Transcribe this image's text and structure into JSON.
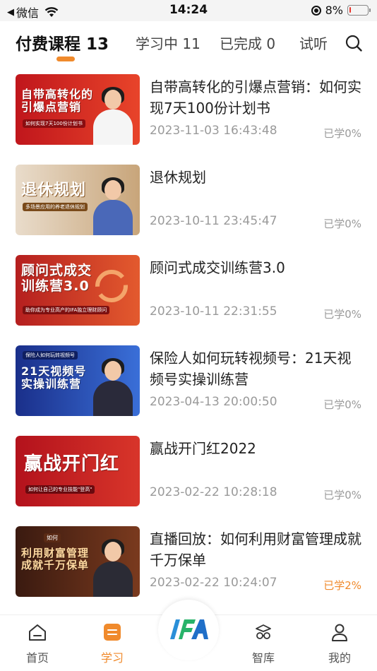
{
  "status_bar": {
    "back_glyph": "◀",
    "carrier": "微信",
    "time": "14:24",
    "battery_percent": "8%",
    "battery_level": 0.08
  },
  "tabs": [
    {
      "label": "付费课程 13",
      "active": true
    },
    {
      "label": "学习中 11",
      "active": false
    },
    {
      "label": "已完成 0",
      "active": false
    },
    {
      "label": "试听",
      "active": false
    }
  ],
  "courses": [
    {
      "title": "自带高转化的引爆点营销：如何实现7天100份计划书",
      "time": "2023-11-03 16:43:48",
      "progress": "已学0%",
      "thumb_title": "自带高转化的\n引爆点营销",
      "thumb_sub": "如何实现7天100份计划书",
      "bg_from": "#c0161c",
      "bg_to": "#e8442a",
      "outfit": "#f5f5f5"
    },
    {
      "title": "退休规划",
      "time": "2023-10-11 23:45:47",
      "progress": "已学0%",
      "thumb_title": "退休规划",
      "thumb_sub": "多场景应用的养老退休规划",
      "bg_from": "#e9dccb",
      "bg_to": "#c8a57a",
      "outfit": "#4a68b8"
    },
    {
      "title": "顾问式成交训练营3.0",
      "time": "2023-10-11 22:31:55",
      "progress": "已学0%",
      "thumb_title": "顾问式成交\n训练营3.0",
      "thumb_sub": "助你成为专业高产的IFA独立理财顾问",
      "bg_from": "#b51f1f",
      "bg_to": "#e35a2e",
      "outfit": "#b51f1f"
    },
    {
      "title": "保险人如何玩转视频号：21天视频号实操训练营",
      "time": "2023-04-13 20:00:50",
      "progress": "已学0%",
      "thumb_title": "21天视频号\n实操训练营",
      "thumb_sub": "保险人如何玩转视频号",
      "bg_from": "#1a2f8a",
      "bg_to": "#3a6fd8",
      "outfit": "#2a2a3a"
    },
    {
      "title": "赢战开门红2022",
      "time": "2023-02-22 10:28:18",
      "progress": "已学0%",
      "thumb_title": "赢战开门红",
      "thumb_sub": "如何让自己的专业技能\"登高\"",
      "bg_from": "#b3121c",
      "bg_to": "#d8352a",
      "outfit": ""
    },
    {
      "title": "直播回放：如何利用财富管理成就千万保单",
      "time": "2023-02-22 10:24:07",
      "progress": "已学2%",
      "thumb_title": "利用财富管理\n成就千万保单",
      "thumb_sub": "如何",
      "bg_from": "#3a1a10",
      "bg_to": "#7a3a1e",
      "outfit": "#2b2b35"
    }
  ],
  "bottom_nav": [
    {
      "label": "首页",
      "icon": "home-icon",
      "active": false
    },
    {
      "label": "学习",
      "icon": "study-icon",
      "active": true
    },
    {
      "label": "IFA",
      "icon": "ifa-logo-icon",
      "active": false
    },
    {
      "label": "智库",
      "icon": "think-tank-icon",
      "active": false
    },
    {
      "label": "我的",
      "icon": "profile-icon",
      "active": false
    }
  ],
  "colors": {
    "accent": "#f08a2c",
    "muted_text": "#9a9a9a",
    "battery_low": "#e8332a"
  }
}
